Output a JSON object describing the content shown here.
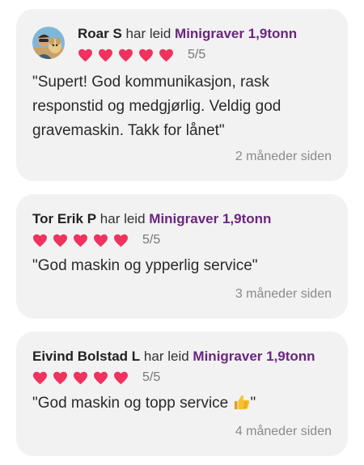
{
  "colors": {
    "card_bg": "#f2f2f2",
    "product_purple": "#6b2580",
    "heart_pink": "#f0325f",
    "timestamp_gray": "#8a8a8a"
  },
  "reviews": [
    {
      "name": "Roar S",
      "verb": "har leid",
      "product": "Minigraver 1,9tonn",
      "rating": 5,
      "rating_text": "5/5",
      "comment": "\"Supert! God kommunikasjon, rask responstid og medgjørlig. Veldig god gravemaskin. Takk for lånet\"",
      "time": "2 måneder siden",
      "has_avatar": true
    },
    {
      "name": "Tor Erik P",
      "verb": "har leid",
      "product": "Minigraver 1,9tonn",
      "rating": 5,
      "rating_text": "5/5",
      "comment": "\"God maskin og ypperlig service\"",
      "time": "3 måneder siden",
      "has_avatar": false
    },
    {
      "name": "Eivind Bolstad L",
      "verb": "har leid",
      "product": "Minigraver 1,9tonn",
      "rating": 5,
      "rating_text": "5/5",
      "comment": "\"God maskin og topp service",
      "comment_end": "\"",
      "comment_emoji": "thumbs-up-icon",
      "time": "4 måneder siden",
      "has_avatar": false
    }
  ]
}
